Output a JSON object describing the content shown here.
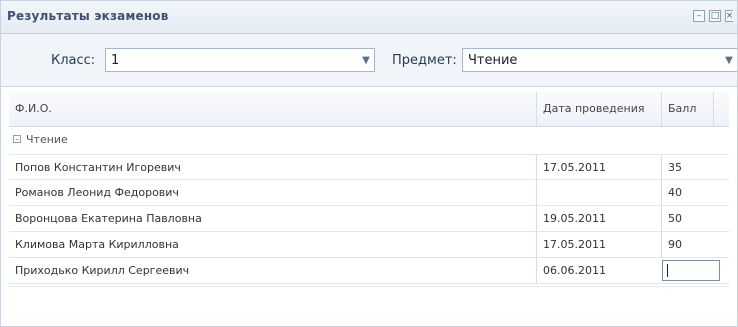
{
  "window": {
    "title": "Результаты экзаменов"
  },
  "filters": {
    "class_label": "Класс:",
    "class_value": "1",
    "subject_label": "Предмет:",
    "subject_value": "Чтение"
  },
  "grid": {
    "columns": [
      "Ф.И.О.",
      "Дата проведения",
      "Балл"
    ],
    "group_label": "Чтение",
    "rows": [
      {
        "name": "Попов Константин Игоревич",
        "date": "17.05.2011",
        "score": "35"
      },
      {
        "name": "Романов Леонид Федорович",
        "date": "",
        "score": "40"
      },
      {
        "name": "Воронцова Екатерина Павловна",
        "date": "19.05.2011",
        "score": "50"
      },
      {
        "name": "Климова Марта Кирилловна",
        "date": "17.05.2011",
        "score": "90"
      },
      {
        "name": "Приходько Кирилл Сергеевич",
        "date": "06.06.2011",
        "score": ""
      }
    ]
  },
  "icons": {
    "minimize": "minimize-icon",
    "maximize": "maximize-icon",
    "close": "close-icon",
    "dropdown": "chevron-down-icon",
    "group_toggle": "collapse-icon"
  },
  "colors": {
    "title_text": "#3d5170",
    "toolbar_bg": "#f1f4f8",
    "border": "#c9d3df"
  }
}
